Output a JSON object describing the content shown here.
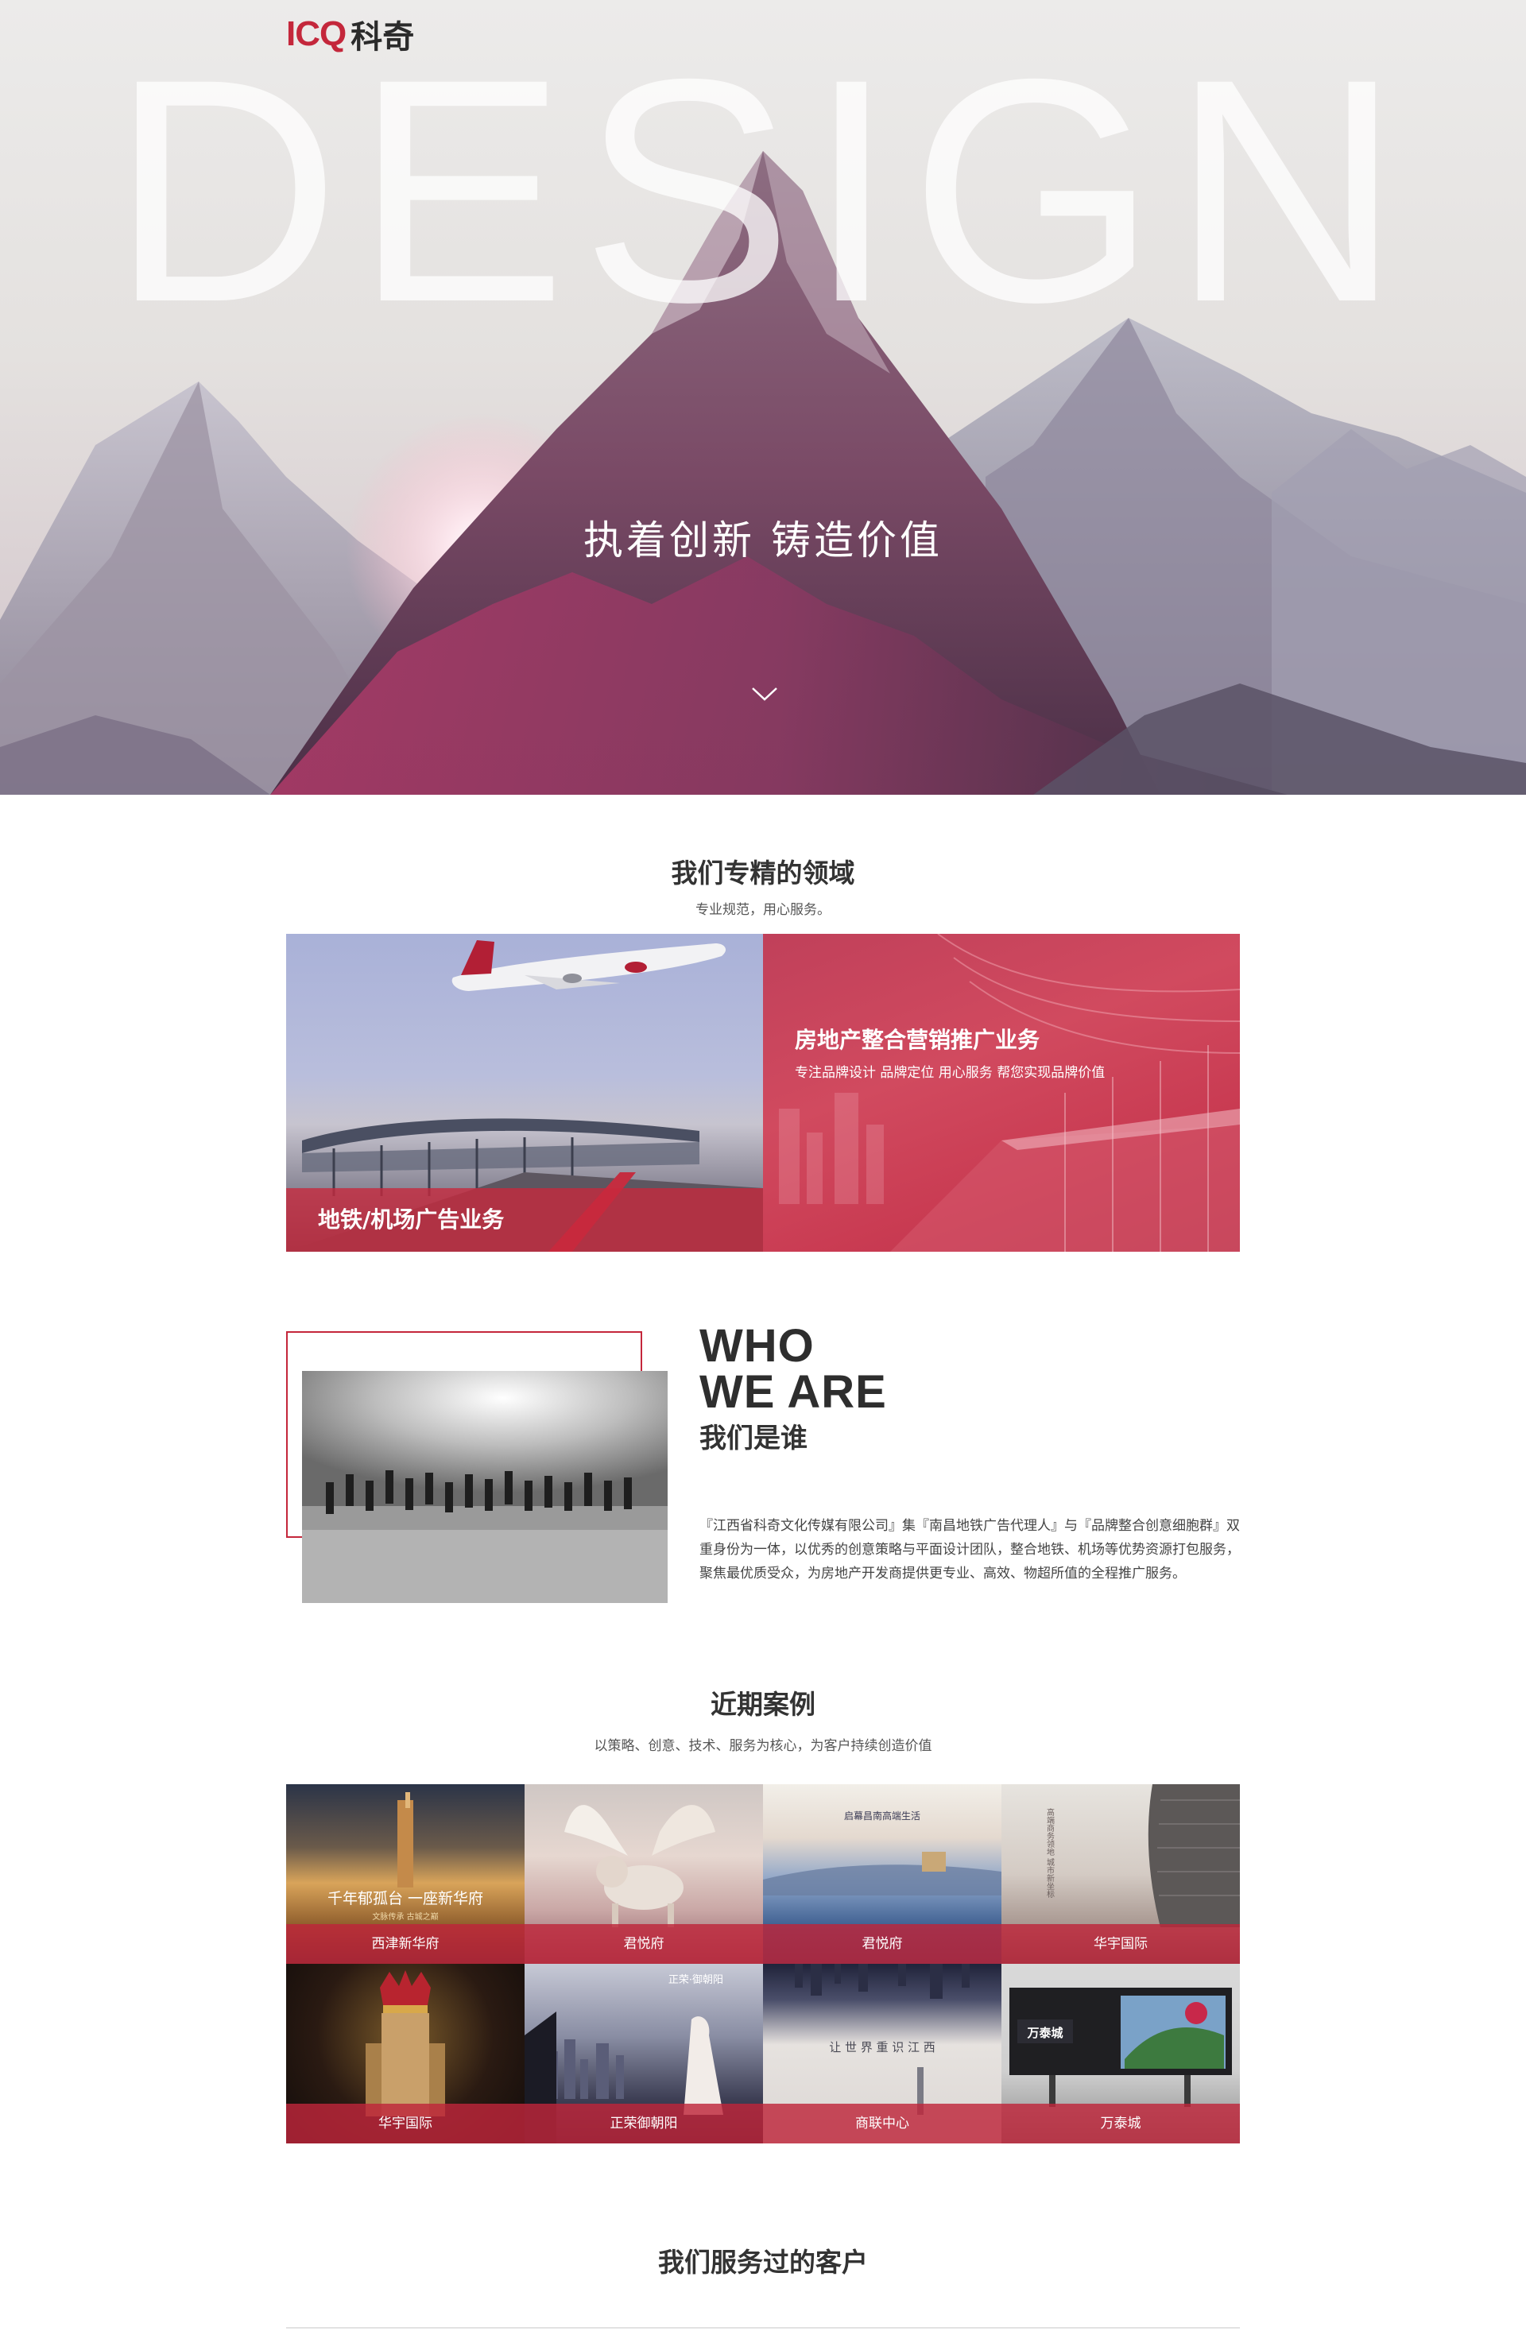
{
  "brand": {
    "mark": "ICQ",
    "name": "科奇",
    "accent": "#c4273b"
  },
  "hero": {
    "bg_word": "DESIGN",
    "slogan": "执着创新  铸造价值"
  },
  "fields": {
    "title": "我们专精的领域",
    "subtitle": "专业规范，用心服务。",
    "items": [
      {
        "label": "地铁/机场广告业务"
      },
      {
        "label": "房地产整合营销推广业务",
        "desc": "专注品牌设计 品牌定位 用心服务 帮您实现品牌价值"
      }
    ]
  },
  "who": {
    "en_line1": "WHO",
    "en_line2": "WE ARE",
    "cn": "我们是谁",
    "text": "『江西省科奇文化传媒有限公司』集『南昌地铁广告代理人』与『品牌整合创意细胞群』双重身份为一体，以优秀的创意策略与平面设计团队，整合地铁、机场等优势资源打包服务，聚焦最优质受众，为房地产开发商提供更专业、高效、物超所值的全程推广服务。"
  },
  "cases": {
    "title": "近期案例",
    "subtitle": "以策略、创意、技术、服务为核心，为客户持续创造价值",
    "items": [
      {
        "label": "西津新华府",
        "headline": "千年郁孤台  一座新华府",
        "sub": "文脉传承  古城之巅"
      },
      {
        "label": "君悦府"
      },
      {
        "label": "君悦府",
        "headline": "启幕昌南高端生活"
      },
      {
        "label": "华宇国际",
        "headline": "高端商务领地  城市新坐标"
      },
      {
        "label": "华宇国际"
      },
      {
        "label": "正荣御朝阳",
        "headline": "正荣·御朝阳"
      },
      {
        "label": "商联中心",
        "headline": "让 世 界 重 识 江 西"
      },
      {
        "label": "万泰城",
        "headline": "万泰城"
      }
    ]
  },
  "clients": {
    "title": "我们服务过的客户"
  }
}
